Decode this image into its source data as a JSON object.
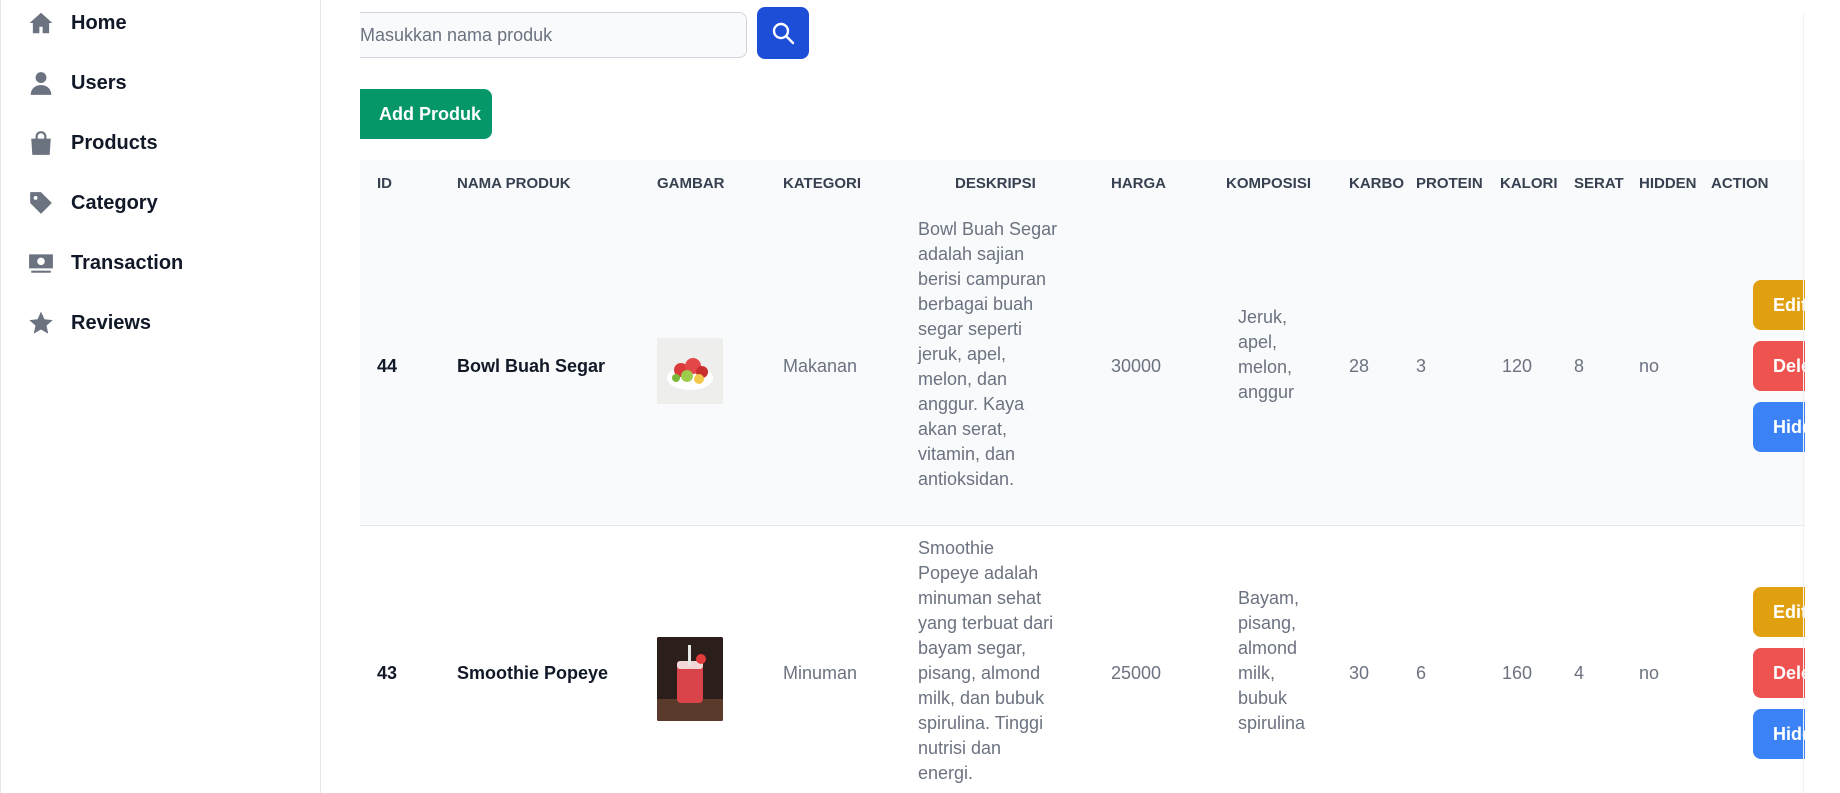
{
  "sidebar": {
    "items": [
      {
        "label": "Home",
        "icon": "home-icon"
      },
      {
        "label": "Users",
        "icon": "user-icon"
      },
      {
        "label": "Products",
        "icon": "shopping-bag-icon"
      },
      {
        "label": "Category",
        "icon": "tag-icon"
      },
      {
        "label": "Transaction",
        "icon": "money-icon"
      },
      {
        "label": "Reviews",
        "icon": "star-icon"
      }
    ]
  },
  "search": {
    "placeholder": "Masukkan nama produk",
    "value": ""
  },
  "toolbar": {
    "add_label": "Add Produk"
  },
  "table": {
    "headers": [
      "ID",
      "NAMA PRODUK",
      "GAMBAR",
      "KATEGORI",
      "DESKRIPSI",
      "HARGA",
      "KOMPOSISI",
      "KARBO",
      "PROTEIN",
      "KALORI",
      "SERAT",
      "HIDDEN",
      "ACTION"
    ],
    "rows": [
      {
        "id": "44",
        "name": "Bowl Buah Segar",
        "category": "Makanan",
        "description": [
          "Bowl Buah Segar",
          "adalah sajian",
          "berisi campuran",
          "berbagai buah",
          "segar seperti",
          "jeruk, apel,",
          "melon, dan",
          "anggur. Kaya",
          "akan serat,",
          "vitamin, dan",
          "antioksidan."
        ],
        "price": "30000",
        "composition": [
          "Jeruk,",
          "apel,",
          "melon,",
          "anggur"
        ],
        "carbs": "28",
        "protein": "3",
        "calories": "120",
        "fiber": "8",
        "hidden": "no",
        "actions": {
          "edit": "Edit",
          "delete": "Delet",
          "hidden": "Hidde"
        }
      },
      {
        "id": "43",
        "name": "Smoothie Popeye",
        "category": "Minuman",
        "description": [
          "Smoothie",
          "Popeye adalah",
          "minuman sehat",
          "yang terbuat dari",
          "bayam segar,",
          "pisang, almond",
          "milk, dan bubuk",
          "spirulina. Tinggi",
          "nutrisi dan",
          "energi."
        ],
        "price": "25000",
        "composition": [
          "Bayam,",
          "pisang,",
          "almond",
          "milk,",
          "bubuk",
          "spirulina"
        ],
        "carbs": "30",
        "protein": "6",
        "calories": "160",
        "fiber": "4",
        "hidden": "no",
        "actions": {
          "edit": "Edit",
          "delete": "Delet",
          "hidden": "Hidde"
        }
      }
    ]
  },
  "colors": {
    "search_button": "#1d4ed8",
    "add_button": "#059669",
    "edit_button": "#e0a010",
    "delete_button": "#ef5350",
    "hidden_button": "#3b82f6"
  }
}
